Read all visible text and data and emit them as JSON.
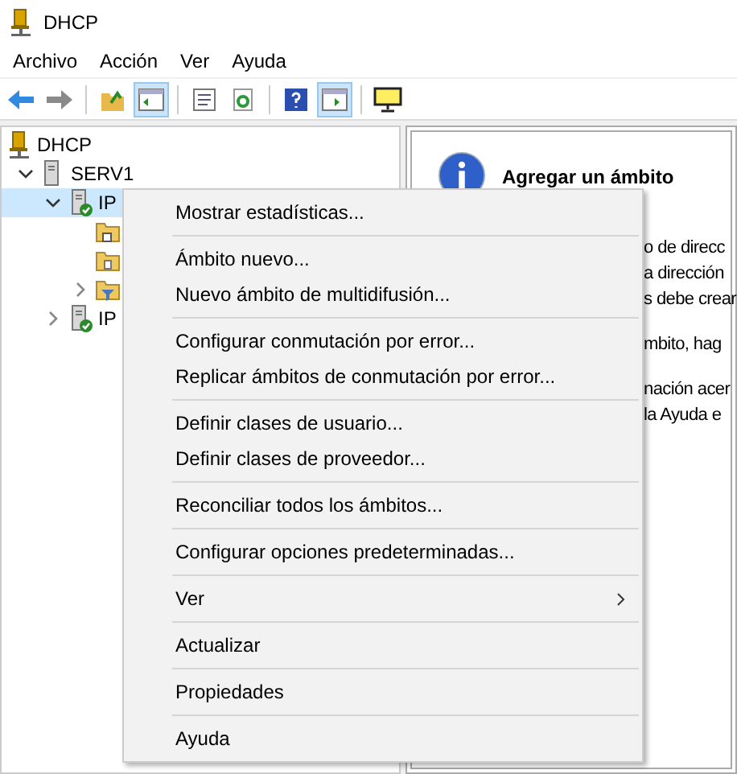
{
  "window": {
    "title": "DHCP"
  },
  "menu_bar": [
    "Archivo",
    "Acción",
    "Ver",
    "Ayuda"
  ],
  "toolbar": [
    {
      "kind": "back",
      "pressed": false
    },
    {
      "kind": "forward",
      "pressed": false
    },
    {
      "kind": "separator"
    },
    {
      "kind": "up-folder",
      "pressed": false
    },
    {
      "kind": "tree-pane",
      "pressed": true
    },
    {
      "kind": "separator"
    },
    {
      "kind": "properties",
      "pressed": false
    },
    {
      "kind": "refresh",
      "pressed": false
    },
    {
      "kind": "separator"
    },
    {
      "kind": "help",
      "pressed": false
    },
    {
      "kind": "action-pane",
      "pressed": true
    },
    {
      "kind": "separator"
    },
    {
      "kind": "monitor",
      "pressed": false
    }
  ],
  "tree": [
    {
      "kind": "dhcp",
      "label": "DHCP",
      "children": [
        {
          "kind": "server",
          "label": "SERV1",
          "expanded": true,
          "children": [
            {
              "kind": "ipv",
              "label": "IP",
              "expanded": true,
              "selected": true,
              "children": [
                {
                  "kind": "folder-options",
                  "expandable": false
                },
                {
                  "kind": "folder-policies",
                  "expandable": false
                },
                {
                  "kind": "folder-filter",
                  "expandable": true
                }
              ]
            },
            {
              "kind": "ipv",
              "label": "IP",
              "expanded": false,
              "selected": false
            }
          ]
        }
      ]
    }
  ],
  "info_panel": {
    "title": "Agregar un ámbito",
    "paragraphs": [
      [
        "o de direcc",
        "a dirección",
        "s debe crear"
      ],
      [
        "mbito, hag"
      ],
      [
        "nación acer",
        "la Ayuda e"
      ]
    ]
  },
  "context_menu": [
    {
      "kind": "item",
      "label": "Mostrar estadísticas..."
    },
    {
      "kind": "separator"
    },
    {
      "kind": "item",
      "label": "Ámbito nuevo..."
    },
    {
      "kind": "item",
      "label": "Nuevo ámbito de multidifusión..."
    },
    {
      "kind": "separator"
    },
    {
      "kind": "item",
      "label": "Configurar conmutación por error..."
    },
    {
      "kind": "item",
      "label": "Replicar ámbitos de conmutación por error..."
    },
    {
      "kind": "separator"
    },
    {
      "kind": "item",
      "label": "Definir clases de usuario..."
    },
    {
      "kind": "item",
      "label": "Definir clases de proveedor..."
    },
    {
      "kind": "separator"
    },
    {
      "kind": "item",
      "label": "Reconciliar todos los ámbitos..."
    },
    {
      "kind": "separator"
    },
    {
      "kind": "item",
      "label": "Configurar opciones predeterminadas..."
    },
    {
      "kind": "separator"
    },
    {
      "kind": "submenu",
      "label": "Ver"
    },
    {
      "kind": "separator"
    },
    {
      "kind": "item",
      "label": "Actualizar"
    },
    {
      "kind": "separator"
    },
    {
      "kind": "item",
      "label": "Propiedades"
    },
    {
      "kind": "separator"
    },
    {
      "kind": "item",
      "label": "Ayuda"
    }
  ]
}
